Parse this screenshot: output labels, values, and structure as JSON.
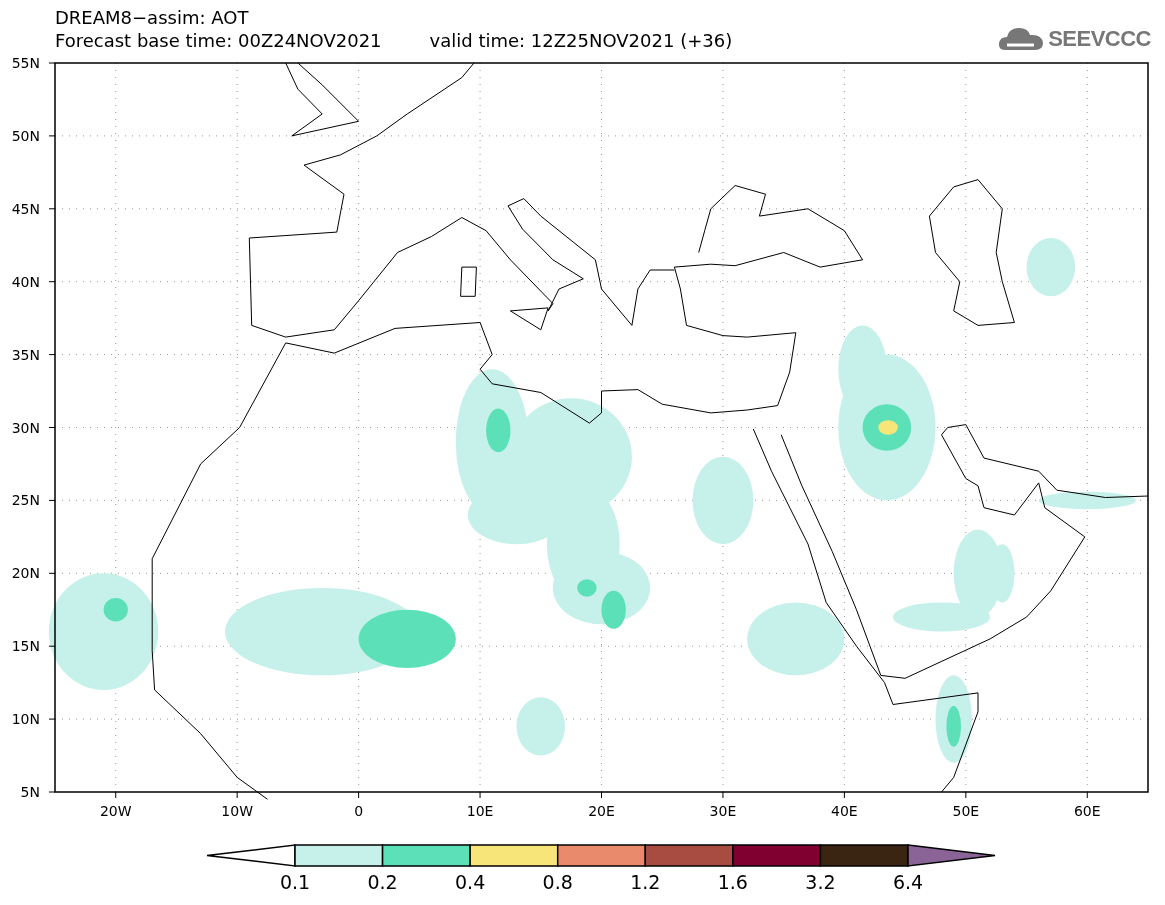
{
  "header": {
    "title": "DREAM8−assim: AOT",
    "base_time": "Forecast base time: 00Z24NOV2021",
    "valid_time": "valid time: 12Z25NOV2021 (+36)",
    "logo_text": "SEEVCCC"
  },
  "map": {
    "y_labels": [
      "55N",
      "50N",
      "45N",
      "40N",
      "35N",
      "30N",
      "25N",
      "20N",
      "15N",
      "10N",
      "5N"
    ],
    "x_labels": [
      "20W",
      "10W",
      "0",
      "10E",
      "20E",
      "30E",
      "40E",
      "50E",
      "60E"
    ]
  },
  "legend": {
    "under": {
      "color": "#ffffff"
    },
    "over": {
      "color": "#8a6496"
    },
    "bins": [
      {
        "color": "#c6f0ea"
      },
      {
        "color": "#5ce0b8"
      },
      {
        "color": "#f8e57a"
      },
      {
        "color": "#ea8a6c"
      },
      {
        "color": "#a84c42"
      },
      {
        "color": "#800030"
      },
      {
        "color": "#3a2412"
      }
    ],
    "labels": [
      "0.1",
      "0.2",
      "0.4",
      "0.8",
      "1.2",
      "1.6",
      "3.2",
      "6.4"
    ]
  }
}
